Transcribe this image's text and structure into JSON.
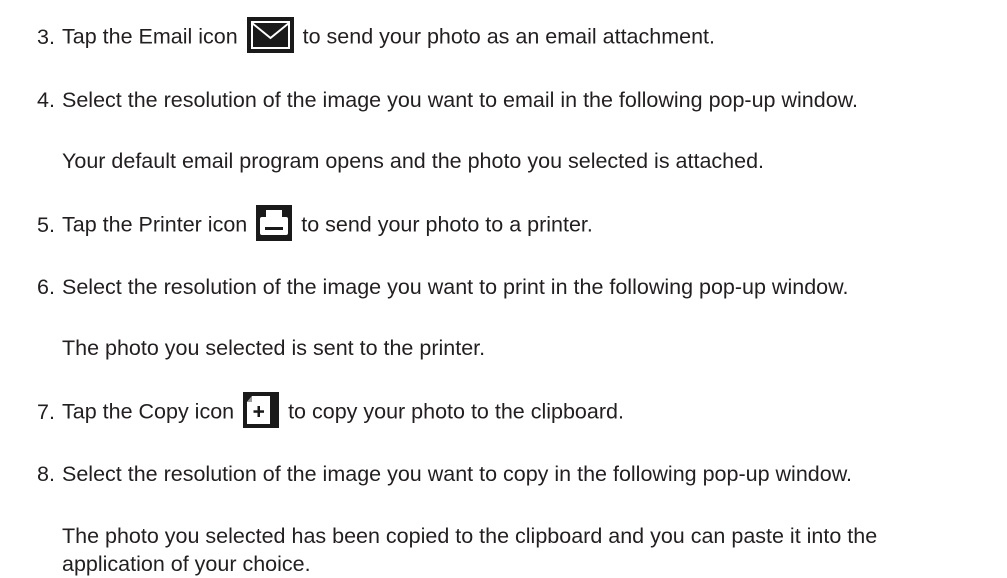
{
  "steps": [
    {
      "number": "3.",
      "before": "Tap the Email icon",
      "icon": "envelope-icon",
      "after": "to send your photo as an email attachment."
    },
    {
      "number": "4.",
      "text": "Select the resolution of the image you want to email in the following pop-up window."
    },
    {
      "note": "Your default email program opens and the photo you selected is attached."
    },
    {
      "number": "5.",
      "before": "Tap the Printer icon",
      "icon": "printer-icon",
      "after": "to send your photo to a printer."
    },
    {
      "number": "6.",
      "text": "Select the resolution of the image you want to print in the following pop-up window."
    },
    {
      "note": "The photo you selected is sent to the printer."
    },
    {
      "number": "7.",
      "before": "Tap the Copy icon",
      "icon": "copy-icon",
      "after": "to copy your photo to the clipboard."
    },
    {
      "number": "8.",
      "text": "Select the resolution of the image you want to copy in the following pop-up window."
    },
    {
      "note": "The photo you selected has been copied to the clipboard and you can paste it into the application of your choice."
    }
  ]
}
